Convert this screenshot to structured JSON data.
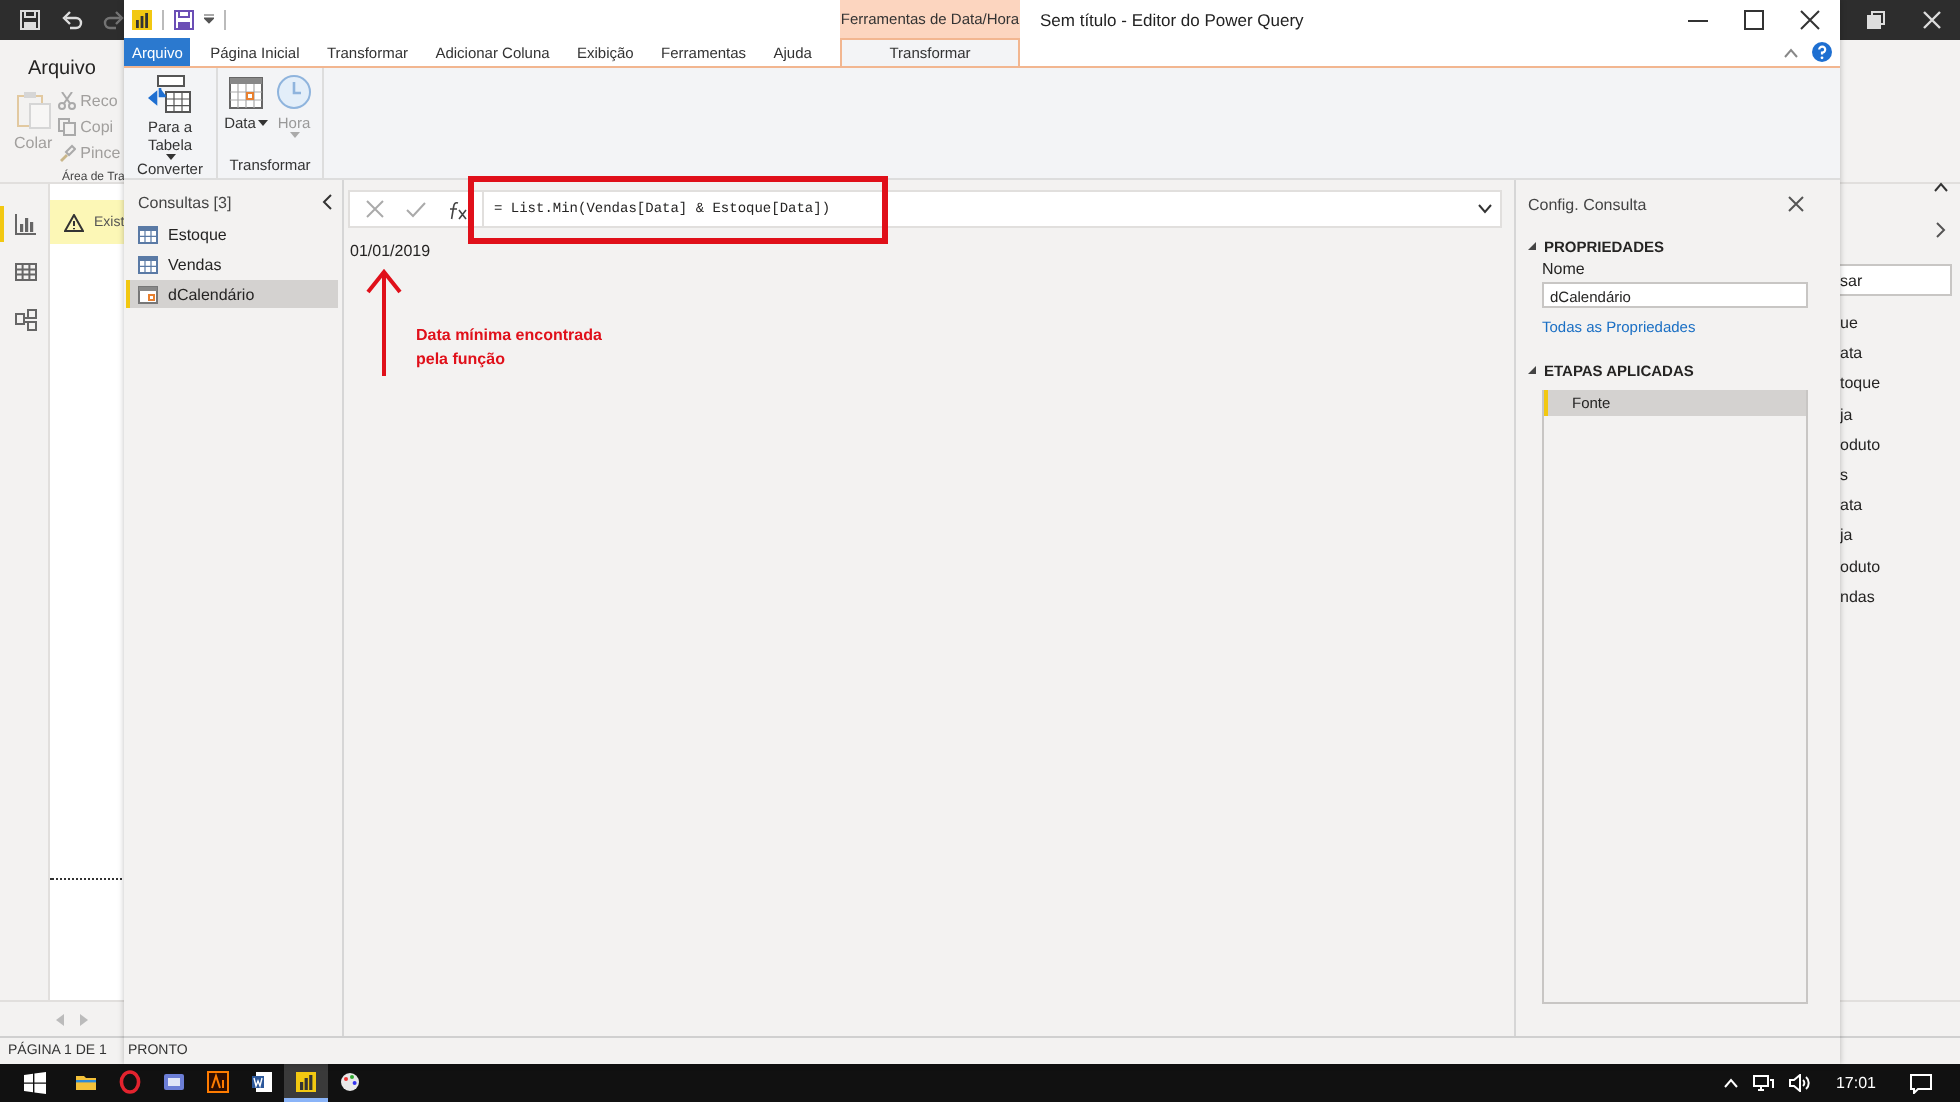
{
  "background_window": {
    "quick_access": [
      {
        "kind": "save",
        "disabled": false
      },
      {
        "kind": "undo",
        "disabled": false
      },
      {
        "kind": "redo",
        "disabled": true
      }
    ],
    "ribbon": {
      "tab": "Arquivo",
      "paste": "Colar",
      "commands": [
        {
          "kind": "cut",
          "label": "Reco"
        },
        {
          "kind": "copy",
          "label": "Copi"
        },
        {
          "kind": "format",
          "label": "Pince"
        }
      ],
      "group_label": "Área de Tra"
    },
    "views": [
      {
        "kind": "report",
        "selected": true
      },
      {
        "kind": "data",
        "selected": false
      },
      {
        "kind": "model",
        "selected": false
      }
    ],
    "warning": {
      "text": "Exist"
    },
    "fields_pane": {
      "search": {
        "value": "sar"
      },
      "items": [
        "ue",
        "ata",
        "toque",
        "ja",
        "oduto",
        "s",
        "ata",
        "ja",
        "oduto",
        "ndas"
      ]
    },
    "status_bar": {
      "page": "PÁGINA 1 DE 1"
    }
  },
  "editor": {
    "title": "Sem título - Editor do Power Query",
    "context_group": "Ferramentas de Data/Hora",
    "tabs": [
      {
        "label": "Arquivo",
        "kind": "file",
        "selected": false
      },
      {
        "label": "Página Inicial",
        "kind": "normal",
        "selected": false
      },
      {
        "label": "Transformar",
        "kind": "normal",
        "selected": false
      },
      {
        "label": "Adicionar Coluna",
        "kind": "normal",
        "selected": false
      },
      {
        "label": "Exibição",
        "kind": "normal",
        "selected": false
      },
      {
        "label": "Ferramentas",
        "kind": "normal",
        "selected": false
      },
      {
        "label": "Ajuda",
        "kind": "normal",
        "selected": false
      },
      {
        "label": "Transformar",
        "kind": "context",
        "selected": true
      }
    ],
    "ribbon_groups": [
      {
        "label": "Converter",
        "buttons": [
          {
            "kind": "table",
            "label": "Para a Tabela",
            "disabled": false
          }
        ]
      },
      {
        "label": "Transformar",
        "buttons": [
          {
            "kind": "date",
            "label": "Data",
            "disabled": false
          },
          {
            "kind": "time",
            "label": "Hora",
            "disabled": true
          }
        ]
      }
    ],
    "queries": {
      "title": "Consultas [3]",
      "items": [
        {
          "label": "Estoque",
          "kind": "table",
          "selected": false
        },
        {
          "label": "Vendas",
          "kind": "table",
          "selected": false
        },
        {
          "label": "dCalendário",
          "kind": "date",
          "selected": true
        }
      ]
    },
    "formula": {
      "value": "= List.Min(Vendas[Data] & Estoque[Data])"
    },
    "result": "01/01/2019",
    "annotation": {
      "text": "Data mínima encontrada pela função"
    },
    "settings": {
      "title": "Config. Consulta",
      "properties_heading": "PROPRIEDADES",
      "name_label": "Nome",
      "name_value": "dCalendário",
      "all_properties_link": "Todas as Propriedades",
      "steps_heading": "ETAPAS APLICADAS",
      "steps": [
        {
          "label": "Fonte",
          "selected": true
        }
      ]
    },
    "status_bar": {
      "text": "PRONTO"
    }
  },
  "taskbar": {
    "apps": [
      {
        "kind": "explorer",
        "selected": false
      },
      {
        "kind": "browser",
        "selected": false
      },
      {
        "kind": "mail",
        "selected": false
      },
      {
        "kind": "design",
        "selected": false
      },
      {
        "kind": "word",
        "selected": false
      },
      {
        "kind": "powerbi",
        "selected": true
      },
      {
        "kind": "paint",
        "selected": false
      }
    ],
    "clock": "17:01"
  }
}
